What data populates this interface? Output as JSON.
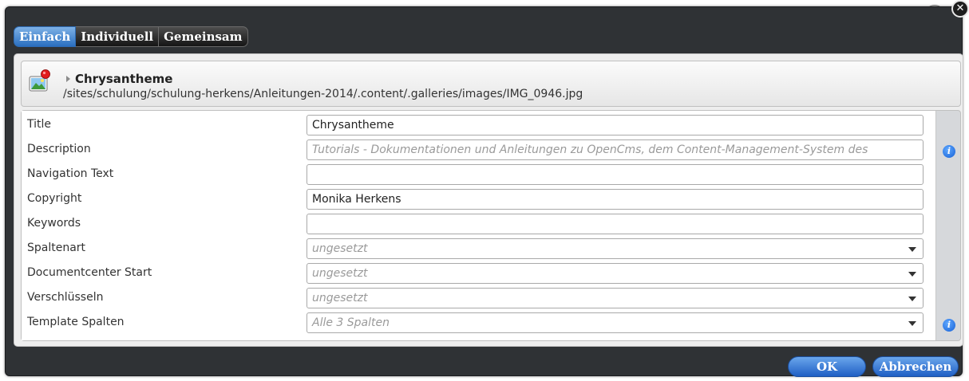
{
  "tabs": [
    {
      "label": "Einfach",
      "active": true
    },
    {
      "label": "Individuell",
      "active": false
    },
    {
      "label": "Gemeinsam",
      "active": false
    }
  ],
  "close_symbol": "✕",
  "resource": {
    "title": "Chrysantheme",
    "path": "/sites/schulung/schulung-herkens/Anleitungen-2014/.content/.galleries/images/IMG_0946.jpg",
    "icon": "image-file-icon"
  },
  "fields": [
    {
      "label": "Title",
      "value": "Chrysantheme",
      "placeholder": "",
      "type": "text"
    },
    {
      "label": "Description",
      "value": "",
      "placeholder": "Tutorials - Dokumentationen und Anleitungen zu OpenCms, dem Content-Management-System des",
      "type": "text",
      "info": true
    },
    {
      "label": "Navigation Text",
      "value": "",
      "placeholder": "",
      "type": "text"
    },
    {
      "label": "Copyright",
      "value": "Monika Herkens",
      "placeholder": "",
      "type": "text"
    },
    {
      "label": "Keywords",
      "value": "",
      "placeholder": "",
      "type": "text"
    },
    {
      "label": "Spaltenart",
      "value": "",
      "placeholder": "ungesetzt",
      "type": "select"
    },
    {
      "label": "Documentcenter Start",
      "value": "",
      "placeholder": "ungesetzt",
      "type": "select"
    },
    {
      "label": "Verschlüsseln",
      "value": "",
      "placeholder": "ungesetzt",
      "type": "select"
    },
    {
      "label": "Template Spalten",
      "value": "",
      "placeholder": "Alle 3 Spalten",
      "type": "select",
      "info": true
    }
  ],
  "buttons": {
    "ok": "OK",
    "cancel": "Abbrechen"
  },
  "colors": {
    "accent": "#2a6fc0",
    "dialog_bg": "#2f3235",
    "info": "#1560d6"
  }
}
